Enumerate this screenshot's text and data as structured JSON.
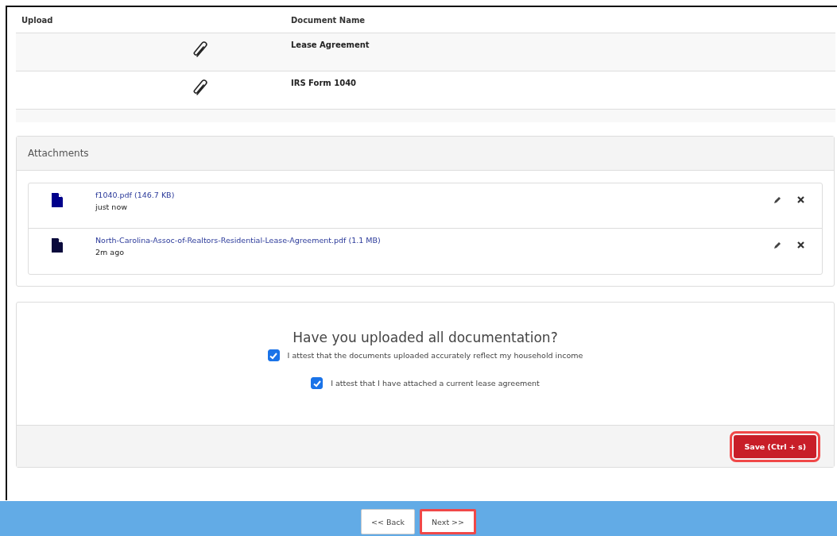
{
  "documents_table": {
    "columns": [
      "Upload",
      "Document Name"
    ],
    "rows": [
      {
        "document_name": "Lease Agreement"
      },
      {
        "document_name": "IRS Form 1040"
      }
    ]
  },
  "attachments": {
    "title": "Attachments",
    "files": [
      {
        "name": "f1040.pdf (146.7 KB)",
        "time": "just now",
        "color": "#00008b"
      },
      {
        "name": "North-Carolina-Assoc-of-Realtors-Residential-Lease-Agreement.pdf (1.1 MB)",
        "time": "2m ago",
        "color": "#0a0a3c"
      }
    ]
  },
  "confirmation": {
    "question": "Have you uploaded all documentation?",
    "attestations": [
      {
        "label": "I attest that the documents uploaded accurately reflect my household income",
        "checked": true
      },
      {
        "label": "I attest that I have attached a current lease agreement",
        "checked": true
      }
    ],
    "save_button": {
      "label": "Save (Ctrl + s)",
      "highlighted": true
    }
  },
  "footer": {
    "buttons": [
      {
        "label": "<< Back",
        "highlighted": false
      },
      {
        "label": "Next >>",
        "highlighted": true
      }
    ]
  }
}
